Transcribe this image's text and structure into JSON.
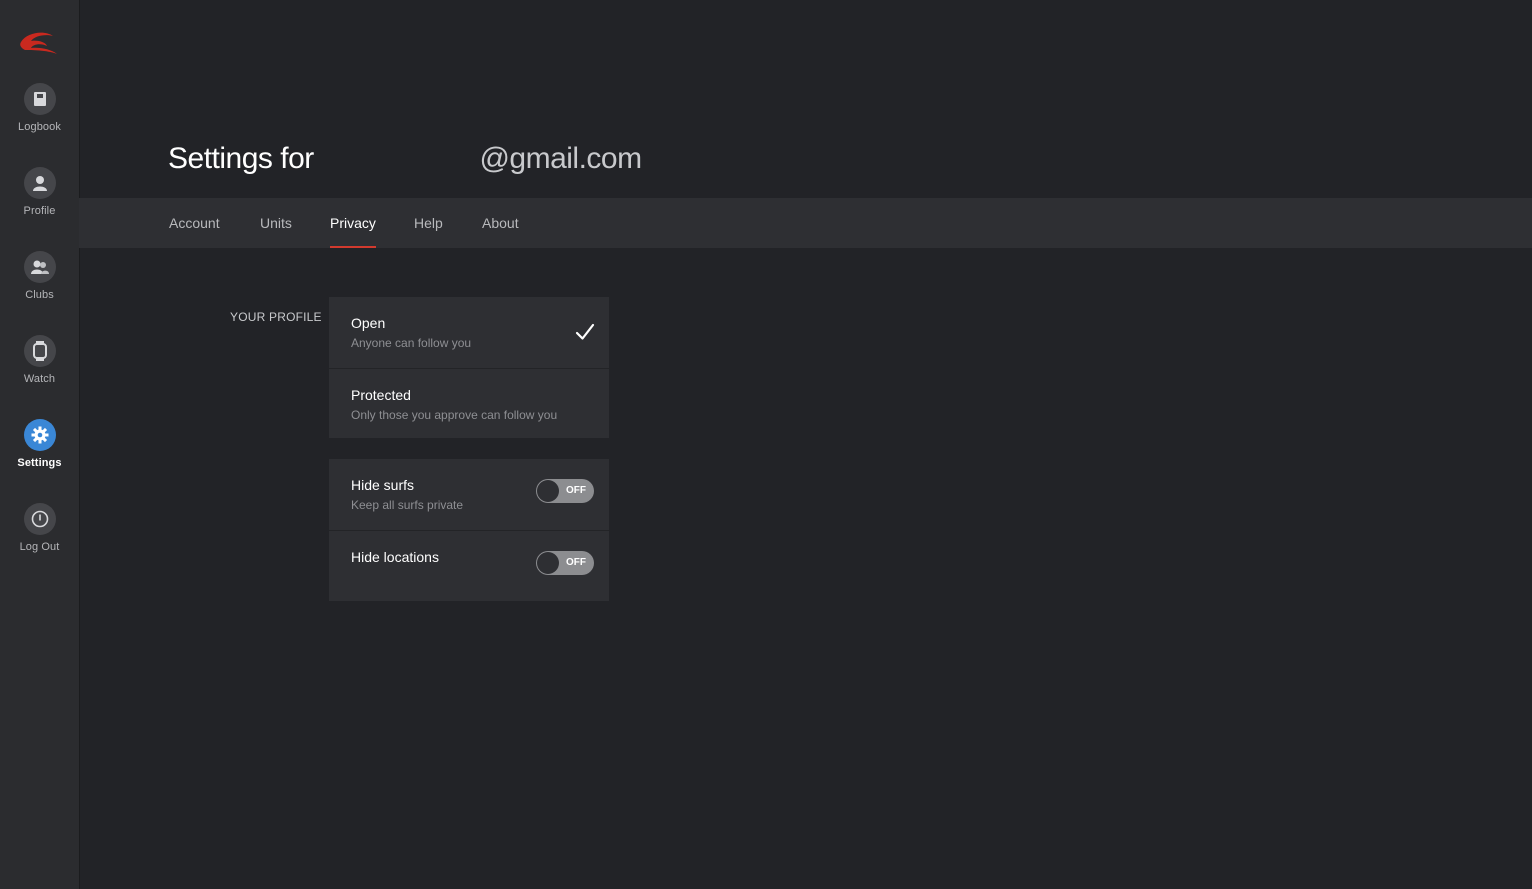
{
  "sidebar": {
    "items": [
      {
        "label": "Logbook",
        "icon": "book-icon"
      },
      {
        "label": "Profile",
        "icon": "person-icon"
      },
      {
        "label": "Clubs",
        "icon": "group-icon"
      },
      {
        "label": "Watch",
        "icon": "watch-icon"
      },
      {
        "label": "Settings",
        "icon": "gear-icon",
        "active": true
      },
      {
        "label": "Log Out",
        "icon": "power-icon"
      }
    ]
  },
  "header": {
    "title_prefix": "Settings for",
    "email_domain": "@gmail.com"
  },
  "tabs": [
    {
      "label": "Account"
    },
    {
      "label": "Units"
    },
    {
      "label": "Privacy",
      "active": true
    },
    {
      "label": "Help"
    },
    {
      "label": "About"
    }
  ],
  "privacy": {
    "section_label": "YOUR PROFILE",
    "profile_options": [
      {
        "title": "Open",
        "subtitle": "Anyone can follow you",
        "selected": true
      },
      {
        "title": "Protected",
        "subtitle": "Only those you approve can follow you",
        "selected": false
      }
    ],
    "toggles": [
      {
        "title": "Hide surfs",
        "subtitle": "Keep all surfs private",
        "state": "OFF"
      },
      {
        "title": "Hide locations",
        "subtitle": "",
        "state": "OFF"
      }
    ]
  },
  "colors": {
    "accent_red": "#d23a2e",
    "active_blue": "#3a87d6",
    "background": "#222327",
    "panel": "#2e2f33"
  }
}
